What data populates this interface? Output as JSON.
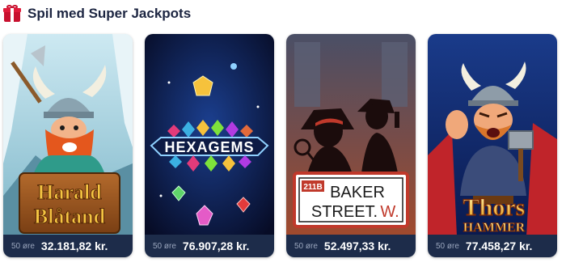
{
  "section": {
    "title": "Spil med Super Jackpots",
    "icon": "gift-icon"
  },
  "games": [
    {
      "name": "Harald Blåtand",
      "logo_line1": "Harald",
      "logo_line2": "Blåtand",
      "stake": "50 øre",
      "jackpot": "32.181,82 kr."
    },
    {
      "name": "Hexagems",
      "logo": "HEXAGEMS",
      "stake": "50 øre",
      "jackpot": "76.907,28 kr."
    },
    {
      "name": "Baker Street",
      "sign_number": "211B",
      "sign_line1": "BAKER",
      "sign_line2": "STREET.",
      "sign_suffix": "W.",
      "stake": "50 øre",
      "jackpot": "52.497,33 kr."
    },
    {
      "name": "Thors Hammer",
      "logo_line1": "Thors",
      "logo_line2": "HAMMER",
      "stake": "50 øre",
      "jackpot": "77.458,27 kr."
    }
  ],
  "colors": {
    "title": "#1c2541",
    "footer_bg": "#1d2c4a",
    "stake_text": "#9aa6bd",
    "amount_text": "#ffffff"
  }
}
